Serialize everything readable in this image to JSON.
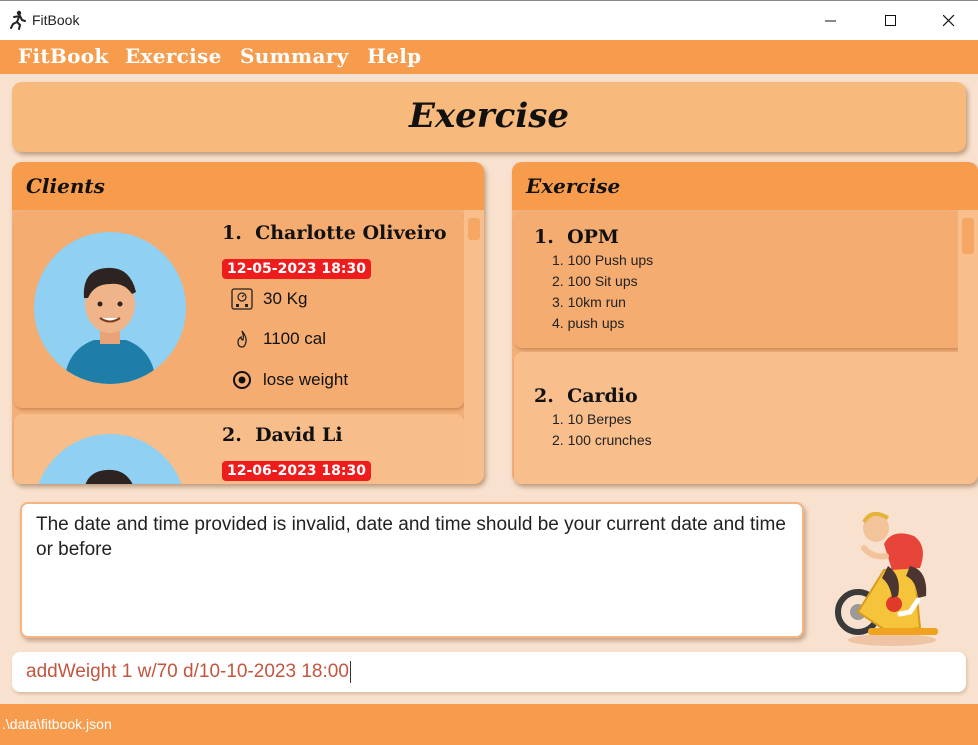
{
  "window": {
    "title": "FitBook"
  },
  "menu": [
    "FitBook",
    "Exercise",
    "Summary",
    "Help"
  ],
  "header": {
    "title": "Exercise"
  },
  "clients_panel": {
    "title": "Clients",
    "clients": [
      {
        "index": "1.",
        "name": "Charlotte Oliveiro",
        "date": "12-05-2023 18:30",
        "weight": "30 Kg",
        "calories": "1100 cal",
        "goal": "lose weight"
      },
      {
        "index": "2.",
        "name": "David Li",
        "date": "12-06-2023 18:30"
      }
    ]
  },
  "exercise_panel": {
    "title": "Exercise",
    "routines": [
      {
        "index": "1.",
        "name": "OPM",
        "items": [
          "1. 100 Push ups",
          "2. 100 Sit ups",
          "3. 10km run",
          "4. push ups"
        ]
      },
      {
        "index": "2.",
        "name": "Cardio",
        "items": [
          "1. 10 Berpes",
          "2. 100 crunches"
        ]
      }
    ]
  },
  "result": {
    "text": "The date and time provided is invalid, date and time should be your current date and time or before"
  },
  "command": {
    "value": "addWeight 1 w/70 d/10-10-2023 18:00"
  },
  "status": {
    "path": ".\\data\\fitbook.json"
  },
  "icons": {
    "app": "runner-icon",
    "weight": "scale-icon",
    "calories": "flame-icon",
    "goal": "target-icon"
  },
  "colors": {
    "menubar": "#f79b4d",
    "card": "#f5ac71",
    "date_badge": "#ee1c1c",
    "command_text": "#c2563f"
  }
}
